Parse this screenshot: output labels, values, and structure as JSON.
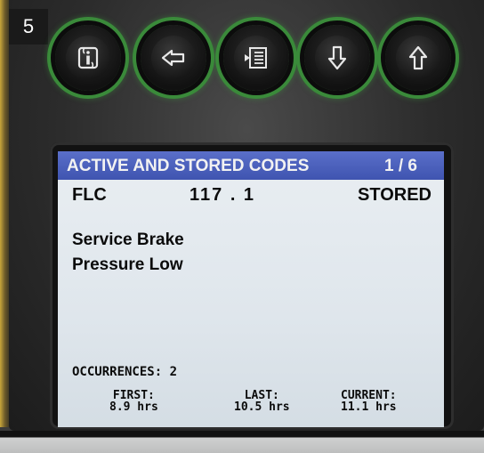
{
  "step_badge": "5",
  "buttons": [
    {
      "name": "info-button",
      "icon": "info-icon"
    },
    {
      "name": "back-button",
      "icon": "arrow-left-icon"
    },
    {
      "name": "menu-button",
      "icon": "menu-list-icon"
    },
    {
      "name": "down-button",
      "icon": "arrow-down-icon"
    },
    {
      "name": "up-button",
      "icon": "arrow-up-icon"
    }
  ],
  "screen": {
    "header": {
      "title": "ACTIVE AND STORED CODES",
      "page": "1 / 6"
    },
    "code": {
      "module": "FLC",
      "number": "117 . 1",
      "status": "STORED"
    },
    "description": {
      "line1": "Service Brake",
      "line2": "Pressure Low"
    },
    "occurrences": "OCCURRENCES:  2",
    "times": {
      "first": {
        "label": "FIRST:",
        "value": "8.9 hrs"
      },
      "last": {
        "label": "LAST:",
        "value": "10.5 hrs"
      },
      "current": {
        "label": "CURRENT:",
        "value": "11.1 hrs"
      }
    }
  },
  "colors": {
    "header_bg": "#4a60bd",
    "button_ring": "#3a8a3a",
    "lcd_bg": "#e3e9ee"
  }
}
